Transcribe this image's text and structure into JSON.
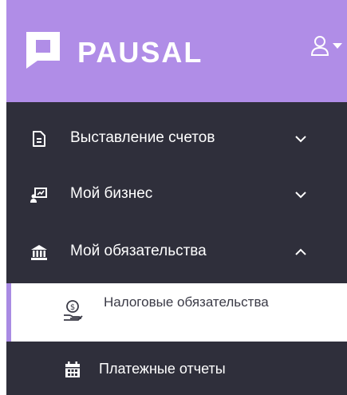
{
  "header": {
    "brand": "PAUSAL",
    "icons": {
      "logo": "logo-mark",
      "user": "user-icon",
      "dropdown": "caret-down-icon"
    }
  },
  "sidebar": {
    "items": [
      {
        "label": "Выставление счетов",
        "icon": "document-icon",
        "expanded": false
      },
      {
        "label": "Мой бизнес",
        "icon": "business-presentation-icon",
        "expanded": false
      },
      {
        "label": "Мой обязательства",
        "icon": "bank-building-icon",
        "expanded": true
      }
    ],
    "subitems": [
      {
        "label": "Налоговые обязательства",
        "icon": "money-hand-icon",
        "active": true
      },
      {
        "label": "Платежные отчеты",
        "icon": "calendar-icon",
        "active": false
      }
    ]
  },
  "colors": {
    "header_bg": "#b08de7",
    "sidebar_bg": "#2f2f3b",
    "active_bg": "#ffffff",
    "accent": "#a98be3"
  }
}
